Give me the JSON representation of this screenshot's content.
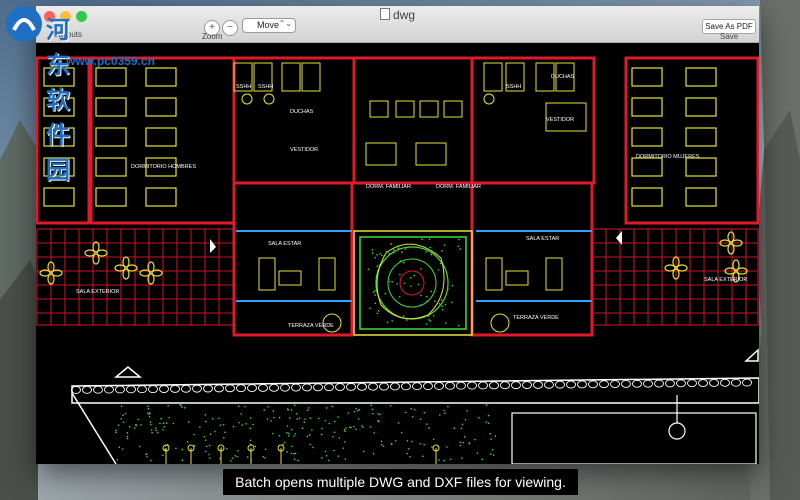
{
  "window": {
    "title": "dwg",
    "toolbar": {
      "layouts_label": "Layouts",
      "zoom_label": "Zoom",
      "zoom_in_glyph": "+",
      "zoom_out_glyph": "−",
      "mode_value": "Move",
      "mode_chevron": "⌃⌄",
      "save_pdf_label": "Save As PDF",
      "save_label": "Save"
    }
  },
  "drawing": {
    "rooms": {
      "duchas_left": "DUCHAS",
      "duchas_right": "DUCHAS",
      "sshh_left": "SSHH",
      "sshh_left2": "SSHH",
      "sshh_right": "SSHH",
      "vestidor_left": "VESTIDOR",
      "vestidor_right": "VESTIDOR",
      "dorm_familiar_left": "DORM. FAMILIAR",
      "dorm_familiar_right": "DORM. FAMILIAR",
      "dormitorio_hombres": "DORMITORIO HOMBRES",
      "dormitorio_mujeres": "DORMITORIO MUJERES",
      "sala_estar_left": "SALA ESTAR",
      "sala_estar_right": "SALA ESTAR",
      "sala_exterior_left": "SALA EXTERIOR",
      "sala_exterior_right": "SALA EXTERIOR",
      "terraza_left": "TERRAZA VERDE",
      "terraza_right": "TERRAZA VERDE"
    }
  },
  "caption": "Batch opens multiple DWG and DXF files for viewing.",
  "watermark": {
    "title": "河东软件园",
    "url": "www.pc0359.cn"
  },
  "colors": {
    "cad_yellow": "#e7e23a",
    "cad_green": "#3fdc3f",
    "cad_red": "#e0192c",
    "cad_white": "#ffffff",
    "accent_blue": "#1f6fc2"
  }
}
